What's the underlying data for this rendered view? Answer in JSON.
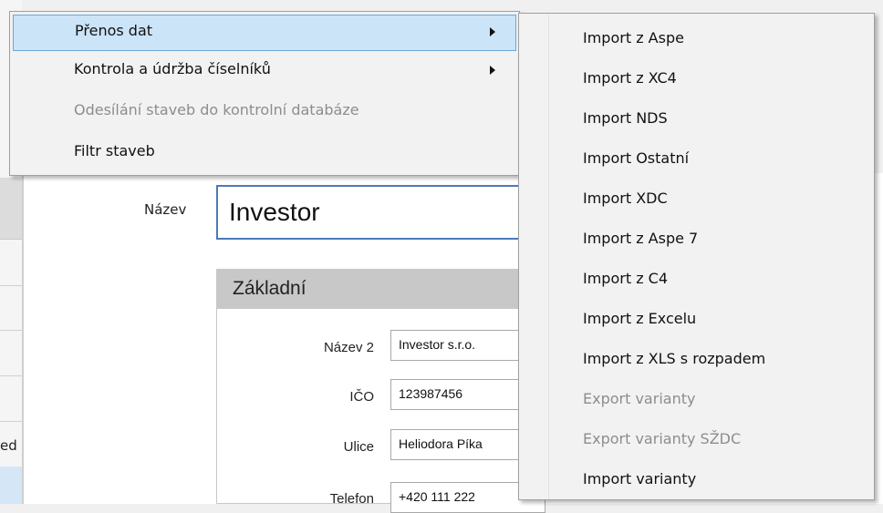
{
  "form": {
    "name_label": "Název",
    "name_value": "Investor",
    "group_title": "Základní",
    "fields": [
      {
        "label": "Název 2",
        "value": "Investor s.r.o."
      },
      {
        "label": "IČO",
        "value": "123987456"
      },
      {
        "label": "Ulice",
        "value": "Heliodora Píka"
      },
      {
        "label": "Telefon",
        "value": "+420 111 222"
      }
    ]
  },
  "background_left": {
    "cut_text": "ed"
  },
  "context_menu": {
    "items": [
      {
        "label": "Přenos dat",
        "has_submenu": true,
        "highlighted": true,
        "enabled": true
      },
      {
        "label": "Kontrola a údržba číselníků",
        "has_submenu": true,
        "highlighted": false,
        "enabled": true
      },
      {
        "label": "Odesílání staveb do kontrolní databáze",
        "has_submenu": false,
        "highlighted": false,
        "enabled": false
      },
      {
        "label": "Filtr staveb",
        "has_submenu": false,
        "highlighted": false,
        "enabled": true
      }
    ]
  },
  "submenu": {
    "items": [
      {
        "label": "Import z Aspe",
        "enabled": true
      },
      {
        "label": "Import z XC4",
        "enabled": true
      },
      {
        "label": "Import NDS",
        "enabled": true
      },
      {
        "label": "Import Ostatní",
        "enabled": true
      },
      {
        "label": "Import XDC",
        "enabled": true
      },
      {
        "label": "Import z Aspe 7",
        "enabled": true
      },
      {
        "label": "Import z C4",
        "enabled": true
      },
      {
        "label": "Import z Excelu",
        "enabled": true
      },
      {
        "label": "Import z XLS s rozpadem",
        "enabled": true
      },
      {
        "label": "Export varianty",
        "enabled": false
      },
      {
        "label": "Export varianty SŽDC",
        "enabled": false
      },
      {
        "label": "Import varianty",
        "enabled": true
      }
    ]
  },
  "icons": {
    "submenu_arrow": "chevron-right-icon"
  },
  "colors": {
    "highlight_bg": "#cce4f7",
    "highlight_border": "#6ea7d8",
    "disabled_text": "#8d8d8d",
    "input_focus_border": "#4a7ab8"
  }
}
